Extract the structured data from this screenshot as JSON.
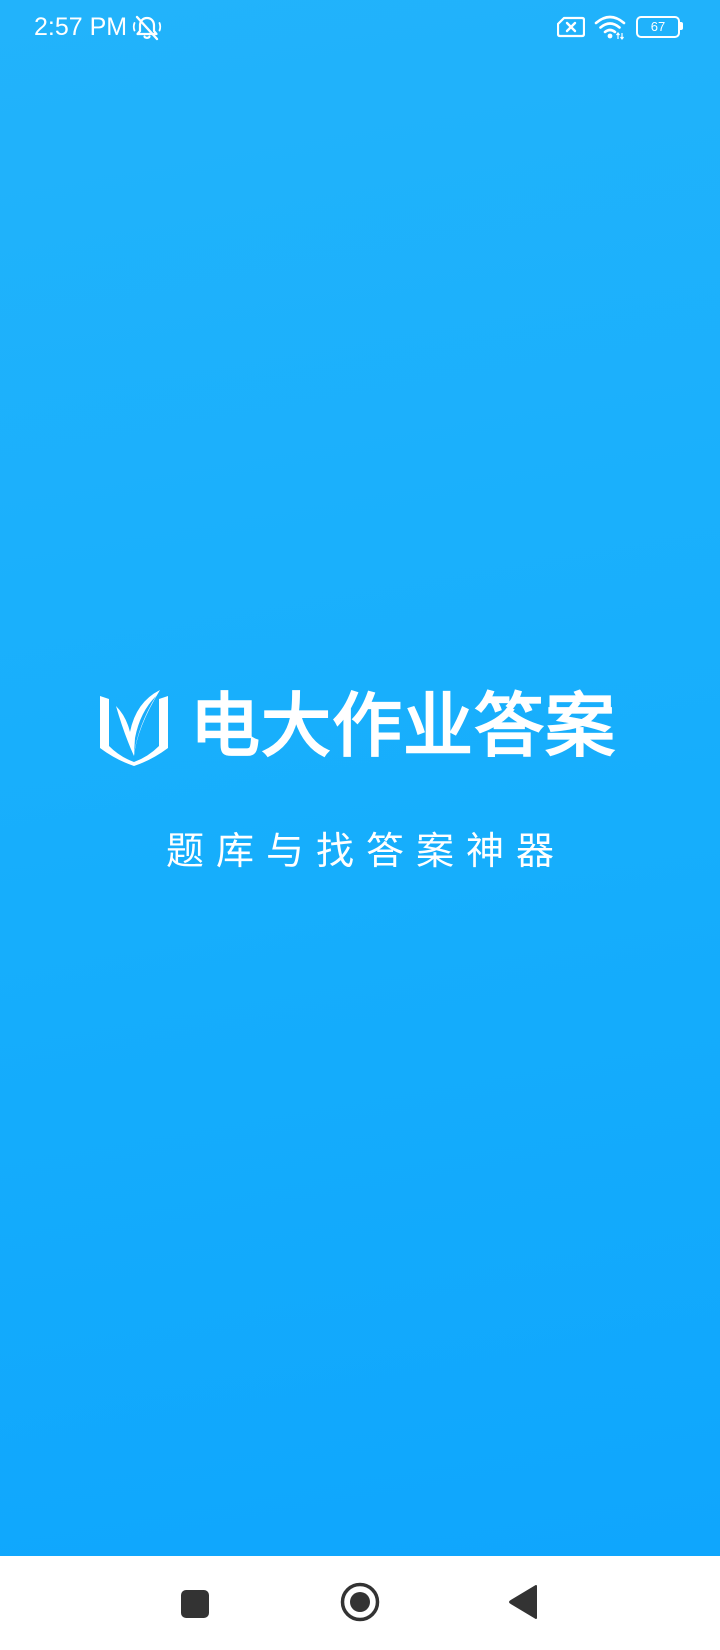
{
  "status_bar": {
    "time": "2:57 PM",
    "battery_level": "67",
    "icons": [
      "notifications-muted-icon",
      "sim-absent-icon",
      "wifi-icon",
      "battery-icon"
    ]
  },
  "brand": {
    "logo_icon": "book-leaf-logo-icon",
    "title": "电大作业答案",
    "tagline": "题库与找答案神器"
  },
  "nav_bar": {
    "icons": [
      "recents-icon",
      "home-icon",
      "back-icon"
    ]
  },
  "colors": {
    "background_top": "#22b3fb",
    "background_bottom": "#0fa6fd",
    "foreground": "#ffffff",
    "nav_bar": "#ffffff",
    "nav_icon": "#333333"
  }
}
